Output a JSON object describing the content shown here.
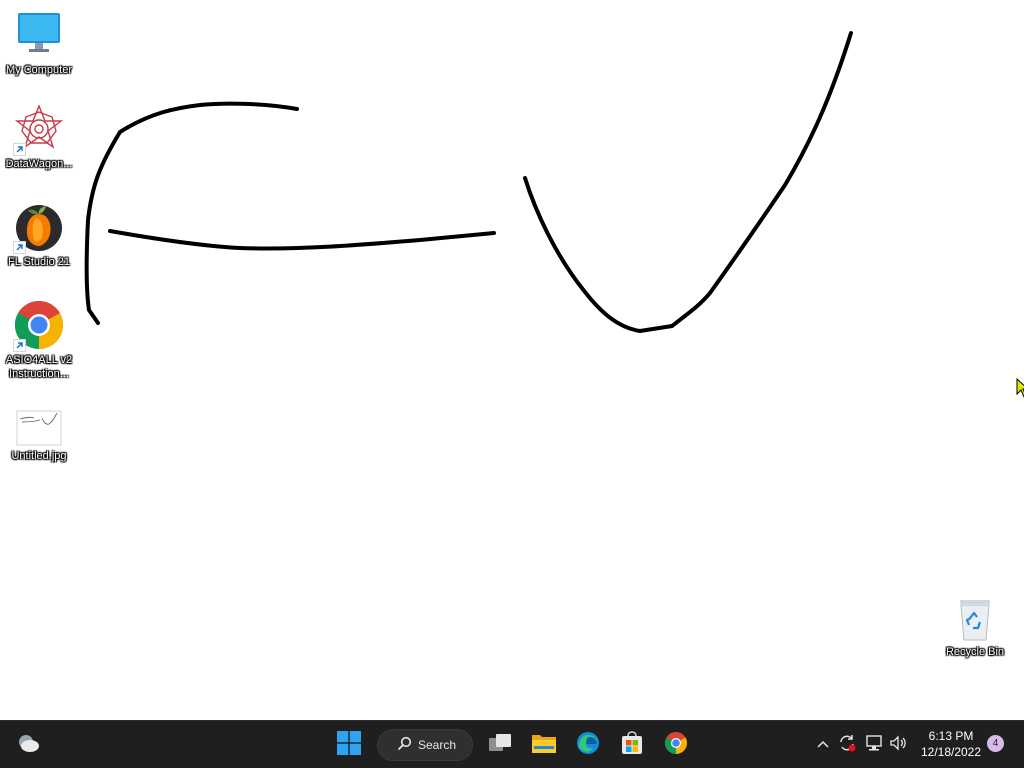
{
  "desktop": {
    "icons": [
      {
        "label": "My Computer",
        "icon": "monitor-icon"
      },
      {
        "label": "DataWagon...",
        "icon": "datawagon-icon",
        "shortcut": true
      },
      {
        "label": "FL Studio 21",
        "icon": "fl-studio-icon",
        "shortcut": true
      },
      {
        "label": "ASIO4ALL v2 Instruction...",
        "icon": "chrome-icon",
        "shortcut": true
      },
      {
        "label": "Untitled.jpg",
        "icon": "image-file-icon"
      },
      {
        "label": "Recycle Bin",
        "icon": "recycle-bin-icon"
      }
    ]
  },
  "taskbar": {
    "search_label": "Search",
    "pinned": [
      "start-icon",
      "search",
      "task-view-icon",
      "file-explorer-icon",
      "edge-icon",
      "store-icon",
      "chrome-icon"
    ],
    "tray": {
      "time": "6:13 PM",
      "date": "12/18/2022",
      "notification_count": "4"
    }
  },
  "colors": {
    "taskbar_bg": "#1f1f1f",
    "desktop_bg": "#ffffff",
    "accent": "#0078d4"
  }
}
